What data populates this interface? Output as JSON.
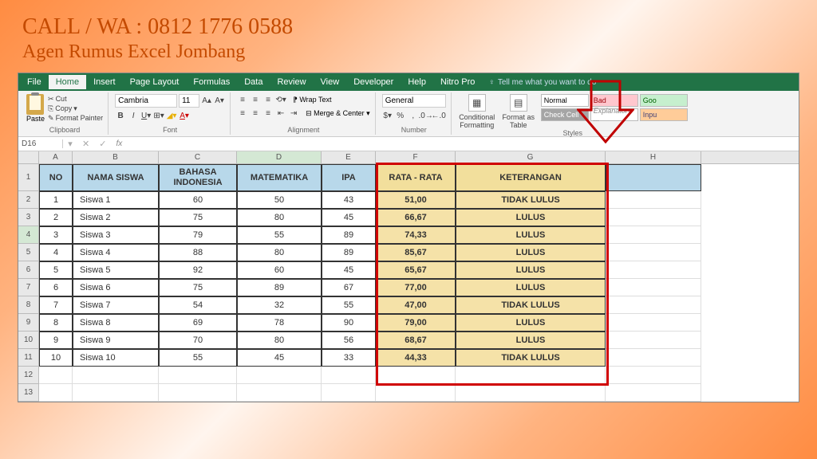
{
  "banner": {
    "line1": "CALL / WA : 0812 1776 0588",
    "line2": "Agen Rumus Excel Jombang"
  },
  "tabs": [
    "File",
    "Home",
    "Insert",
    "Page Layout",
    "Formulas",
    "Data",
    "Review",
    "View",
    "Developer",
    "Help",
    "Nitro Pro"
  ],
  "active_tab": "Home",
  "tellme": "Tell me what you want to do",
  "clipboard": {
    "cut": "Cut",
    "copy": "Copy",
    "painter": "Format Painter",
    "label": "Clipboard",
    "paste": "Paste"
  },
  "font": {
    "name": "Cambria",
    "size": "11",
    "label": "Font"
  },
  "align": {
    "wrap": "Wrap Text",
    "merge": "Merge & Center",
    "label": "Alignment"
  },
  "number": {
    "format": "General",
    "label": "Number"
  },
  "cond": "Conditional\nFormatting",
  "fmttbl": "Format as\nTable",
  "styles": {
    "normal": "Normal",
    "bad": "Bad",
    "good": "Goo",
    "check": "Check Cell",
    "exp": "Explanatory ...",
    "inp": "Inpu",
    "label": "Styles"
  },
  "namebox": "D16",
  "cols": [
    "A",
    "B",
    "C",
    "D",
    "E",
    "F",
    "G",
    "H"
  ],
  "headers": {
    "no": "NO",
    "nama": "NAMA SISWA",
    "bi": "BAHASA INDONESIA",
    "mat": "MATEMATIKA",
    "ipa": "IPA",
    "rata": "RATA - RATA",
    "ket": "KETERANGAN"
  },
  "rows": [
    {
      "no": "1",
      "nama": "Siswa 1",
      "bi": "60",
      "mat": "50",
      "ipa": "43",
      "rata": "51,00",
      "ket": "TIDAK LULUS"
    },
    {
      "no": "2",
      "nama": "Siswa 2",
      "bi": "75",
      "mat": "80",
      "ipa": "45",
      "rata": "66,67",
      "ket": "LULUS"
    },
    {
      "no": "3",
      "nama": "Siswa 3",
      "bi": "79",
      "mat": "55",
      "ipa": "89",
      "rata": "74,33",
      "ket": "LULUS"
    },
    {
      "no": "4",
      "nama": "Siswa 4",
      "bi": "88",
      "mat": "80",
      "ipa": "89",
      "rata": "85,67",
      "ket": "LULUS"
    },
    {
      "no": "5",
      "nama": "Siswa 5",
      "bi": "92",
      "mat": "60",
      "ipa": "45",
      "rata": "65,67",
      "ket": "LULUS"
    },
    {
      "no": "6",
      "nama": "Siswa 6",
      "bi": "75",
      "mat": "89",
      "ipa": "67",
      "rata": "77,00",
      "ket": "LULUS"
    },
    {
      "no": "7",
      "nama": "Siswa 7",
      "bi": "54",
      "mat": "32",
      "ipa": "55",
      "rata": "47,00",
      "ket": "TIDAK LULUS"
    },
    {
      "no": "8",
      "nama": "Siswa 8",
      "bi": "69",
      "mat": "78",
      "ipa": "90",
      "rata": "79,00",
      "ket": "LULUS"
    },
    {
      "no": "9",
      "nama": "Siswa 9",
      "bi": "70",
      "mat": "80",
      "ipa": "56",
      "rata": "68,67",
      "ket": "LULUS"
    },
    {
      "no": "10",
      "nama": "Siswa 10",
      "bi": "55",
      "mat": "45",
      "ipa": "33",
      "rata": "44,33",
      "ket": "TIDAK LULUS"
    }
  ],
  "selected_row": 4
}
